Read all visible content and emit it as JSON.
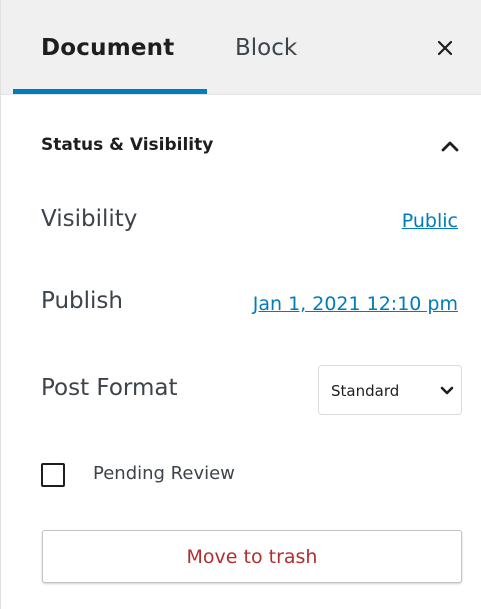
{
  "tabs": {
    "document_label": "Document",
    "block_label": "Block",
    "close_icon": "close-icon"
  },
  "section": {
    "title": "Status & Visibility",
    "toggle_icon": "chevron-up-icon"
  },
  "visibility": {
    "label": "Visibility",
    "value": "Public"
  },
  "publish": {
    "label": "Publish",
    "value": "Jan 1, 2021 12:10 pm"
  },
  "post_format": {
    "label": "Post Format",
    "selected": "Standard",
    "caret_icon": "chevron-down-icon"
  },
  "pending_review": {
    "label": "Pending Review",
    "checked": false
  },
  "trash": {
    "label": "Move to trash"
  },
  "colors": {
    "accent": "#007cba",
    "danger": "#b32d2e",
    "tab_bar_bg": "#f0f0f0"
  }
}
